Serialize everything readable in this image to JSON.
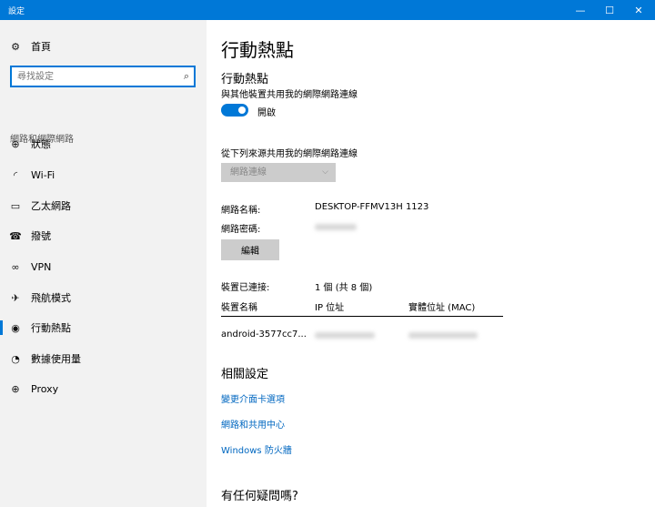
{
  "window": {
    "title": "設定",
    "minimize_icon": "—",
    "maximize_icon": "☐",
    "close_icon": "✕"
  },
  "sidebar": {
    "home_label": "首頁",
    "search_placeholder": "尋找設定",
    "section_header": "網路和網際網路",
    "items": [
      {
        "label": "狀態",
        "icon": "status-icon",
        "glyph": "⊕"
      },
      {
        "label": "Wi-Fi",
        "icon": "wifi-icon",
        "glyph": "◜"
      },
      {
        "label": "乙太網路",
        "icon": "ethernet-icon",
        "glyph": "▭"
      },
      {
        "label": "撥號",
        "icon": "dialup-icon",
        "glyph": "☎"
      },
      {
        "label": "VPN",
        "icon": "vpn-icon",
        "glyph": "∞"
      },
      {
        "label": "飛航模式",
        "icon": "airplane-icon",
        "glyph": "✈"
      },
      {
        "label": "行動熱點",
        "icon": "hotspot-icon",
        "glyph": "◉"
      },
      {
        "label": "數據使用量",
        "icon": "data-usage-icon",
        "glyph": "◔"
      },
      {
        "label": "Proxy",
        "icon": "globe-icon",
        "glyph": "⊕"
      }
    ],
    "active_index": 6,
    "accent": "#0078d7"
  },
  "main": {
    "page_title": "行動熱點",
    "hotspot": {
      "heading": "行動熱點",
      "description": "與其他裝置共用我的網際網路連線",
      "toggle_label": "開啟",
      "toggle_on": true
    },
    "share_from": {
      "label": "從下列來源共用我的網際網路連線",
      "dropdown_value": "網路連線"
    },
    "network_name_label": "網路名稱:",
    "network_name_value": "DESKTOP-FFMV13H 1123",
    "network_password_label": "網路密碼:",
    "edit_button": "編輯",
    "devices_connected_label": "裝置已連接:",
    "devices_connected_value": "1 個 (共 8 個)",
    "table": {
      "headers": [
        "裝置名稱",
        "IP 位址",
        "實體位址 (MAC)"
      ],
      "rows": [
        {
          "device": "android-3577cc7..."
        }
      ]
    },
    "related_settings": {
      "heading": "相關設定",
      "links": [
        "變更介面卡選項",
        "網路和共用中心",
        "Windows 防火牆"
      ]
    },
    "help_heading": "有任何疑問嗎?"
  }
}
